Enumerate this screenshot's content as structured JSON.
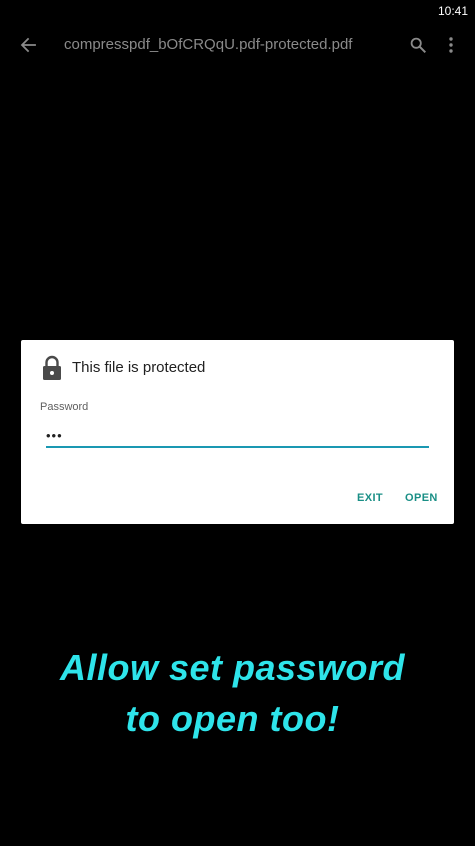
{
  "status_bar": {
    "time": "10:41"
  },
  "app_bar": {
    "back_icon": "arrow-back-icon",
    "title": "compresspdf_bOfCRQqU.pdf-protected.pdf",
    "search_icon": "search-icon",
    "more_icon": "more-vert-icon"
  },
  "dialog": {
    "icon": "lock-icon",
    "title": "This file is protected",
    "field_label": "Password",
    "password_value": "•••",
    "exit_label": "EXIT",
    "open_label": "OPEN"
  },
  "promo": {
    "line1": "Allow set password",
    "line2": "to open too!"
  },
  "colors": {
    "background": "#000000",
    "accent_underline": "#1a98b2",
    "button_text": "#1a8f86",
    "promo_text": "#2ee4ea"
  }
}
